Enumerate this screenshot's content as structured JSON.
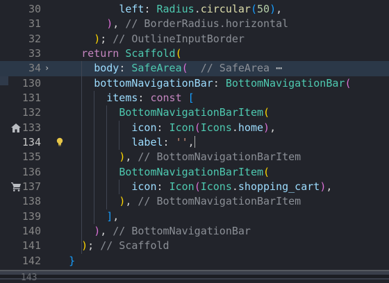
{
  "editor": {
    "icons": {
      "home": "home-icon",
      "cart": "shopping-cart-icon",
      "bulb": "lightbulb-icon",
      "fold": "chevron-right-icon"
    },
    "lines": [
      {
        "n": "30",
        "tokens": [
          {
            "t": "          ",
            "c": "pn"
          },
          {
            "t": "left",
            "c": "prop"
          },
          {
            "t": ": ",
            "c": "pn"
          },
          {
            "t": "Radius",
            "c": "cls"
          },
          {
            "t": ".",
            "c": "pn"
          },
          {
            "t": "circular",
            "c": "fn"
          },
          {
            "t": "(",
            "c": "b3"
          },
          {
            "t": "50",
            "c": "num"
          },
          {
            "t": ")",
            "c": "b3"
          },
          {
            "t": ",",
            "c": "pn"
          }
        ]
      },
      {
        "n": "31",
        "tokens": [
          {
            "t": "        ",
            "c": "pn"
          },
          {
            "t": ")",
            "c": "b2"
          },
          {
            "t": ", ",
            "c": "pn"
          },
          {
            "t": "// BorderRadius.horizontal",
            "c": "cm"
          }
        ]
      },
      {
        "n": "32",
        "tokens": [
          {
            "t": "      ",
            "c": "pn"
          },
          {
            "t": ")",
            "c": "b1"
          },
          {
            "t": "; ",
            "c": "pn"
          },
          {
            "t": "// OutlineInputBorder",
            "c": "cm"
          }
        ]
      },
      {
        "n": "33",
        "tokens": [
          {
            "t": "    ",
            "c": "pn"
          },
          {
            "t": "return",
            "c": "kw"
          },
          {
            "t": " ",
            "c": "pn"
          },
          {
            "t": "Scaffold",
            "c": "cls"
          },
          {
            "t": "(",
            "c": "b1"
          }
        ]
      },
      {
        "n": "34",
        "fold": true,
        "hl": true,
        "tokens": [
          {
            "t": "      ",
            "c": "pn"
          },
          {
            "t": "body",
            "c": "prop"
          },
          {
            "t": ": ",
            "c": "pn"
          },
          {
            "t": "SafeArea",
            "c": "cls"
          },
          {
            "t": "(",
            "c": "b2"
          },
          {
            "t": "  ",
            "c": "pn"
          },
          {
            "t": "// SafeArea",
            "c": "cm"
          },
          {
            "t": " ⋯",
            "c": "pn"
          }
        ]
      },
      {
        "n": "130",
        "tokens": [
          {
            "t": "      ",
            "c": "pn"
          },
          {
            "t": "bottomNavigationBar",
            "c": "prop"
          },
          {
            "t": ": ",
            "c": "pn"
          },
          {
            "t": "BottomNavigationBar",
            "c": "cls"
          },
          {
            "t": "(",
            "c": "b2"
          }
        ]
      },
      {
        "n": "131",
        "tokens": [
          {
            "t": "        ",
            "c": "pn"
          },
          {
            "t": "items",
            "c": "prop"
          },
          {
            "t": ": ",
            "c": "pn"
          },
          {
            "t": "const",
            "c": "kw"
          },
          {
            "t": " ",
            "c": "pn"
          },
          {
            "t": "[",
            "c": "b3"
          }
        ]
      },
      {
        "n": "132",
        "tokens": [
          {
            "t": "          ",
            "c": "pn"
          },
          {
            "t": "BottomNavigationBarItem",
            "c": "cls"
          },
          {
            "t": "(",
            "c": "b1"
          }
        ]
      },
      {
        "n": "133",
        "icon": "home",
        "tokens": [
          {
            "t": "            ",
            "c": "pn"
          },
          {
            "t": "icon",
            "c": "prop"
          },
          {
            "t": ": ",
            "c": "pn"
          },
          {
            "t": "Icon",
            "c": "cls"
          },
          {
            "t": "(",
            "c": "b2"
          },
          {
            "t": "Icons",
            "c": "cls"
          },
          {
            "t": ".",
            "c": "pn"
          },
          {
            "t": "home",
            "c": "prop"
          },
          {
            "t": ")",
            "c": "b2"
          },
          {
            "t": ",",
            "c": "pn"
          }
        ]
      },
      {
        "n": "134",
        "active": true,
        "bulb": true,
        "tokens": [
          {
            "t": "            ",
            "c": "pn"
          },
          {
            "t": "label",
            "c": "prop"
          },
          {
            "t": ": ",
            "c": "pn"
          },
          {
            "t": "''",
            "c": "str"
          },
          {
            "t": ",",
            "c": "pn"
          },
          {
            "t": "",
            "c": "cursor"
          }
        ]
      },
      {
        "n": "135",
        "tokens": [
          {
            "t": "          ",
            "c": "pn"
          },
          {
            "t": ")",
            "c": "b1"
          },
          {
            "t": ", ",
            "c": "pn"
          },
          {
            "t": "// BottomNavigationBarItem",
            "c": "cm"
          }
        ]
      },
      {
        "n": "136",
        "tokens": [
          {
            "t": "          ",
            "c": "pn"
          },
          {
            "t": "BottomNavigationBarItem",
            "c": "cls"
          },
          {
            "t": "(",
            "c": "b1"
          }
        ]
      },
      {
        "n": "137",
        "icon": "cart",
        "tokens": [
          {
            "t": "            ",
            "c": "pn"
          },
          {
            "t": "icon",
            "c": "prop"
          },
          {
            "t": ": ",
            "c": "pn"
          },
          {
            "t": "Icon",
            "c": "cls"
          },
          {
            "t": "(",
            "c": "b2"
          },
          {
            "t": "Icons",
            "c": "cls"
          },
          {
            "t": ".",
            "c": "pn"
          },
          {
            "t": "shopping_cart",
            "c": "prop"
          },
          {
            "t": ")",
            "c": "b2"
          },
          {
            "t": ",",
            "c": "pn"
          }
        ]
      },
      {
        "n": "138",
        "tokens": [
          {
            "t": "          ",
            "c": "pn"
          },
          {
            "t": ")",
            "c": "b1"
          },
          {
            "t": ", ",
            "c": "pn"
          },
          {
            "t": "// BottomNavigationBarItem",
            "c": "cm"
          }
        ]
      },
      {
        "n": "139",
        "tokens": [
          {
            "t": "        ",
            "c": "pn"
          },
          {
            "t": "]",
            "c": "b3"
          },
          {
            "t": ",",
            "c": "pn"
          }
        ]
      },
      {
        "n": "140",
        "tokens": [
          {
            "t": "      ",
            "c": "pn"
          },
          {
            "t": ")",
            "c": "b2"
          },
          {
            "t": ", ",
            "c": "pn"
          },
          {
            "t": "// BottomNavigationBar",
            "c": "cm"
          }
        ]
      },
      {
        "n": "141",
        "tokens": [
          {
            "t": "    ",
            "c": "pn"
          },
          {
            "t": ")",
            "c": "b1"
          },
          {
            "t": "; ",
            "c": "pn"
          },
          {
            "t": "// Scaffold",
            "c": "cm"
          }
        ]
      },
      {
        "n": "142",
        "tokens": [
          {
            "t": "  ",
            "c": "pn"
          },
          {
            "t": "}",
            "c": "b3"
          }
        ]
      }
    ],
    "partial_line_number": "143"
  }
}
